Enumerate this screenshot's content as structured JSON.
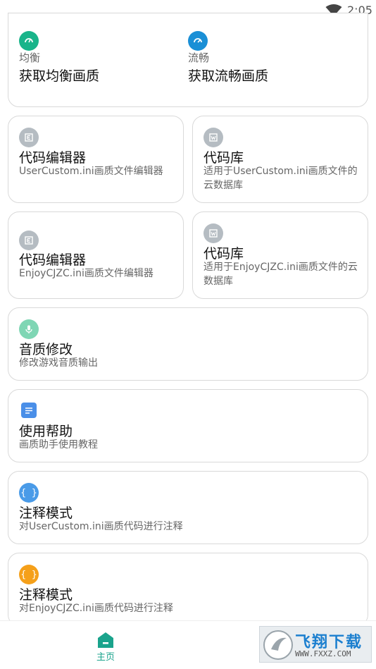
{
  "status_bar": {
    "time": "2:05"
  },
  "quality_card": {
    "balanced": {
      "tag": "均衡",
      "title": "获取均衡画质",
      "color": "#19b48a"
    },
    "smooth": {
      "tag": "流畅",
      "title": "获取流畅画质",
      "color": "#1a8fd6"
    }
  },
  "cards": {
    "editor_usercustom": {
      "title": "代码编辑器",
      "subtitle": "UserCustom.ini画质文件编辑器"
    },
    "library_usercustom": {
      "title": "代码库",
      "subtitle": "适用于UserCustom.ini画质文件的云数据库"
    },
    "editor_enjoy": {
      "title": "代码编辑器",
      "subtitle": "EnjoyCJZC.ini画质文件编辑器"
    },
    "library_enjoy": {
      "title": "代码库",
      "subtitle": "适用于EnjoyCJZC.ini画质文件的云数据库"
    },
    "audio": {
      "title": "音质修改",
      "subtitle": "修改游戏音质输出"
    },
    "help": {
      "title": "使用帮助",
      "subtitle": "画质助手使用教程"
    },
    "annotate_usercustom": {
      "title": "注释模式",
      "subtitle": "对UserCustom.ini画质代码进行注释"
    },
    "annotate_enjoy": {
      "title": "注释模式",
      "subtitle": "对EnjoyCJZC.ini画质代码进行注释"
    }
  },
  "icons": {
    "balanced": "gauge-icon",
    "smooth": "gauge-icon",
    "editor": "editor-icon",
    "library": "library-icon",
    "audio": "microphone-icon",
    "help": "document-icon",
    "annotate": "braces-icon"
  },
  "colors": {
    "editor_icon": "#b5bcc2",
    "audio_icon": "#7fd6b4",
    "help_icon": "#4a8fe8",
    "annotate_blue": "#4a9be8",
    "annotate_orange": "#f5a01a",
    "accent": "#1aa38c"
  },
  "bottom_nav": {
    "home_label": "主页"
  },
  "watermark": {
    "brand": "飞翔下载",
    "url": "WWW.FXXZ.COM"
  }
}
